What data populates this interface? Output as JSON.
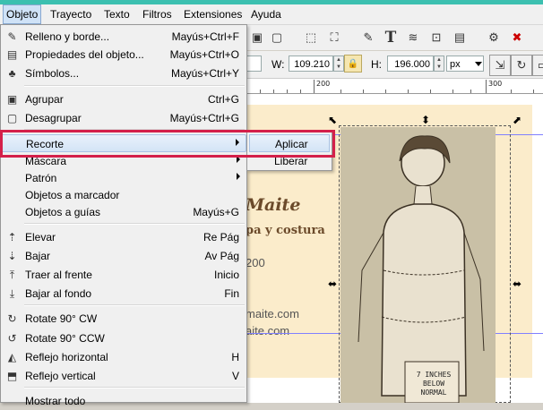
{
  "menubar": {
    "items": [
      {
        "label": "Objeto",
        "active": true
      },
      {
        "label": "Trayecto"
      },
      {
        "label": "Texto"
      },
      {
        "label": "Filtros"
      },
      {
        "label": "Extensiones"
      },
      {
        "label": "Ayuda"
      }
    ]
  },
  "toolbar2": {
    "w_label": "W:",
    "w_value": "109.210",
    "h_label": "H:",
    "h_value": "196.000",
    "unit": "px"
  },
  "ruler": {
    "labels": [
      "200",
      "300"
    ]
  },
  "menu": {
    "items": [
      {
        "icon": "fill-stroke-icon",
        "label": "Relleno y borde...",
        "shortcut": "Mayús+Ctrl+F"
      },
      {
        "icon": "object-properties-icon",
        "label": "Propiedades del objeto...",
        "shortcut": "Mayús+Ctrl+O"
      },
      {
        "icon": "symbols-icon",
        "label": "Símbolos...",
        "shortcut": "Mayús+Ctrl+Y"
      },
      {
        "icon": "group-icon",
        "label": "Agrupar",
        "shortcut": "Ctrl+G"
      },
      {
        "icon": "ungroup-icon",
        "label": "Desagrupar",
        "shortcut": "Mayús+Ctrl+G"
      },
      {
        "label": "Recorte",
        "submenu": true
      },
      {
        "label": "Máscara",
        "submenu": true
      },
      {
        "label": "Patrón",
        "submenu": true
      },
      {
        "label": "Objetos a marcador",
        "shortcut": ""
      },
      {
        "label": "Objetos a guías",
        "shortcut": "Mayús+G"
      },
      {
        "icon": "raise-icon",
        "label": "Elevar",
        "shortcut": "Re Pág"
      },
      {
        "icon": "lower-icon",
        "label": "Bajar",
        "shortcut": "Av Pág"
      },
      {
        "icon": "raise-to-top-icon",
        "label": "Traer al frente",
        "shortcut": "Inicio"
      },
      {
        "icon": "lower-to-bottom-icon",
        "label": "Bajar al fondo",
        "shortcut": "Fin"
      },
      {
        "icon": "rotate-cw-icon",
        "label": "Rotate 90° CW",
        "shortcut": ""
      },
      {
        "icon": "rotate-ccw-icon",
        "label": "Rotate 90° CCW",
        "shortcut": ""
      },
      {
        "icon": "flip-horizontal-icon",
        "label": "Reflejo horizontal",
        "shortcut": "H"
      },
      {
        "icon": "flip-vertical-icon",
        "label": "Reflejo vertical",
        "shortcut": "V"
      },
      {
        "label": "Mostrar todo",
        "shortcut": ""
      }
    ]
  },
  "submenu": {
    "items": [
      {
        "label": "Aplicar"
      },
      {
        "label": "Liberar"
      }
    ]
  },
  "canvas": {
    "title": "Maite",
    "subtitle": "pa y costura",
    "num": "200",
    "email1": "maite.com",
    "email2": "aite.com",
    "photo_note": "7 INCHES BELOW NORMAL"
  },
  "colors": {
    "highlight_box": "#d4204a",
    "card_bg": "#fbeccb",
    "accent_strip": "#3cc0b0"
  }
}
